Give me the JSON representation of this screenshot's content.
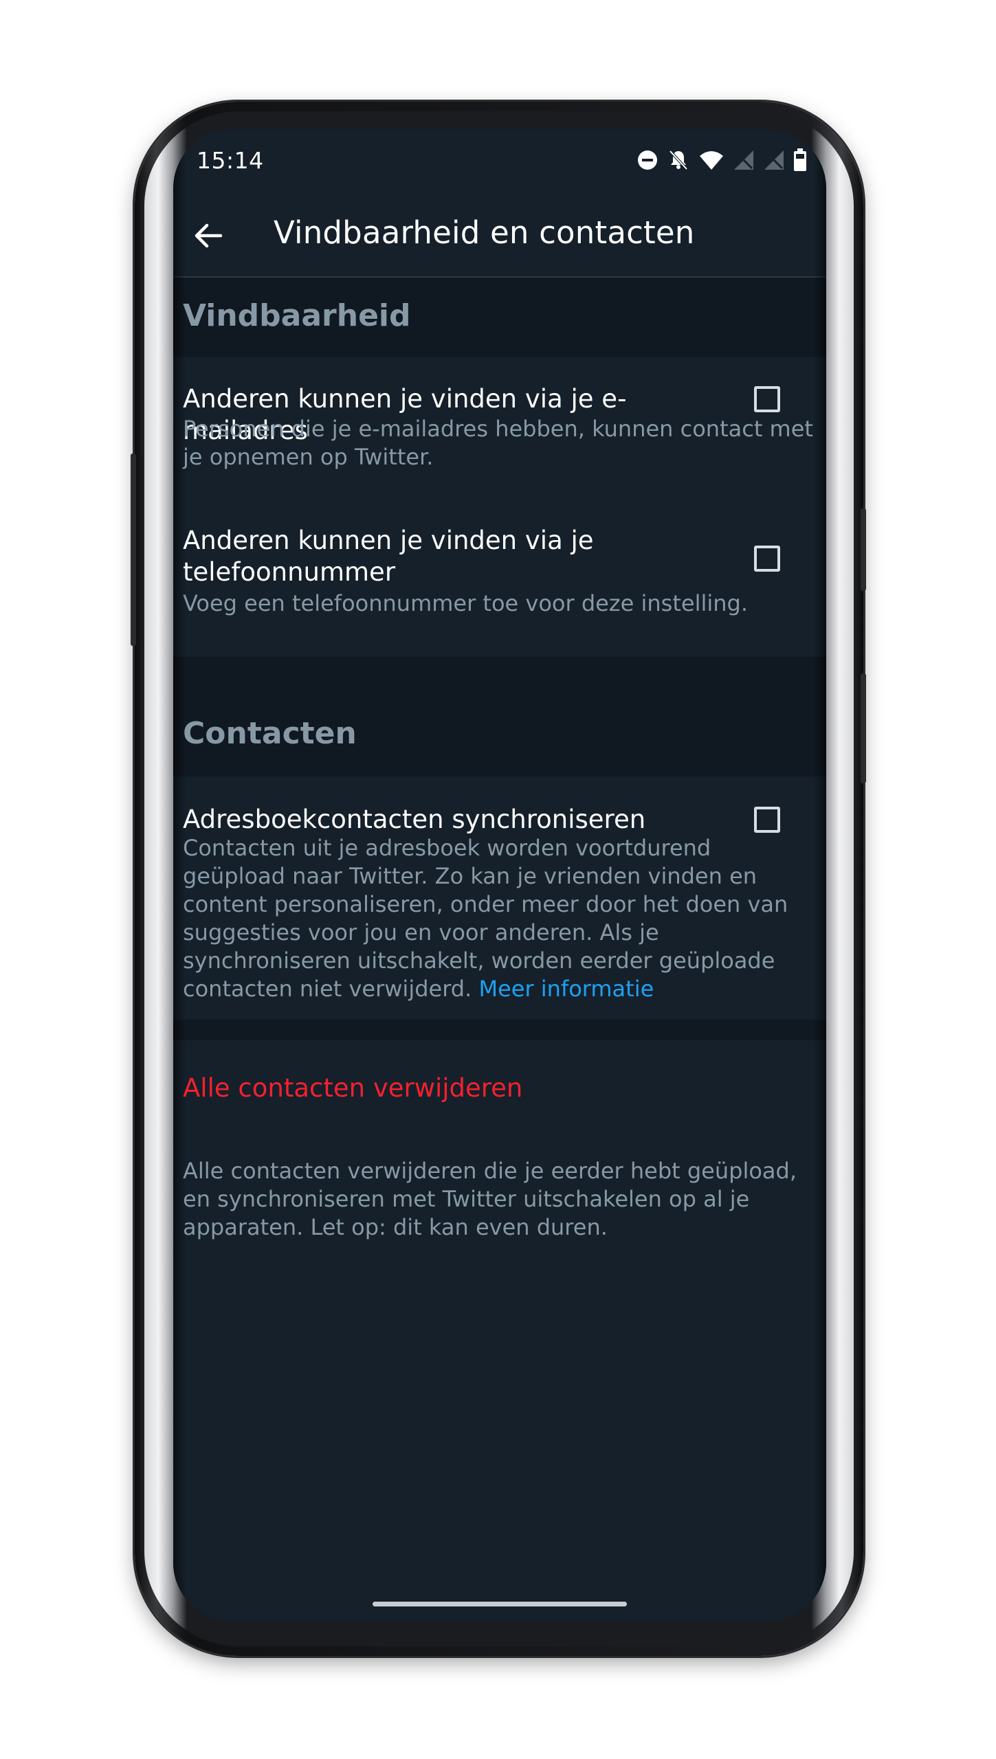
{
  "status_bar": {
    "time": "15:14",
    "icons": [
      "do-not-disturb-icon",
      "bell-off-icon",
      "wifi-icon",
      "signal-off-icon",
      "signal-off-icon",
      "battery-icon"
    ]
  },
  "app_bar": {
    "back_icon": "arrow-left-icon",
    "title": "Vindbaarheid en contacten"
  },
  "sections": {
    "findability": {
      "header": "Vindbaarheid",
      "email": {
        "title": "Anderen kunnen je vinden via je e-mailadres",
        "subtitle": "Personen die je e-mailadres hebben, kunnen contact met je opnemen op Twitter.",
        "checked": false
      },
      "phone": {
        "title": "Anderen kunnen je vinden via je telefoonnummer",
        "subtitle": "Voeg een telefoonnummer toe voor deze instelling.",
        "checked": false
      }
    },
    "contacts": {
      "header": "Contacten",
      "sync": {
        "title": "Adresboekcontacten synchroniseren",
        "subtitle": "Contacten uit je adresboek worden voortdurend geüpload naar Twitter. Zo kan je vrienden vinden en content personaliseren, onder meer door het doen van suggesties voor jou en voor anderen. Als je synchroniseren uitschakelt, worden eerder geüploade contacten niet verwijderd.",
        "link": "Meer informatie",
        "checked": false
      }
    },
    "delete": {
      "label": "Alle contacten verwijderen",
      "description": "Alle contacten verwijderen die je eerder hebt geüpload, en synchroniseren met Twitter uitschakelen op al je apparaten. Let op: dit kan even duren."
    }
  },
  "colors": {
    "background": "#15202b",
    "section_background": "#101821",
    "secondary_text": "#8899a6",
    "link": "#1da1f2",
    "danger": "#f4212e"
  }
}
